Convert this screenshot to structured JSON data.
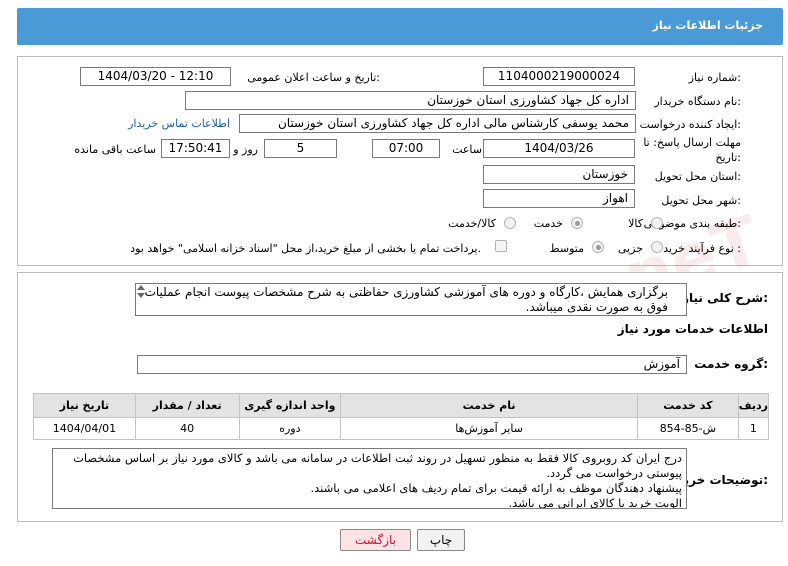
{
  "header": {
    "title": "جزئیات اطلاعات نیاز"
  },
  "form": {
    "need_number_label": "شماره نیاز:",
    "need_number": "1104000219000024",
    "announce_label": "تاریخ و ساعت اعلان عمومی:",
    "announce_value": "1404/03/20 - 12:10",
    "buyer_org_label": "نام دستگاه خریدار:",
    "buyer_org": "اداره کل جهاد کشاورزی استان خوزستان",
    "requester_label": "ایجاد کننده درخواست:",
    "requester": "محمد یوسفی کارشناس مالی اداره کل جهاد کشاورزی استان خوزستان",
    "contact_link": "اطلاعات تماس خریدار",
    "deadline_label_1": "مهلت ارسال پاسخ: تا",
    "deadline_label_2": "تاریخ:",
    "deadline_date": "1404/03/26",
    "hour_label": "ساعت",
    "deadline_time": "07:00",
    "days_value": "5",
    "days_label": "روز و",
    "remaining_time": "17:50:41",
    "remaining_label": "ساعت باقی مانده",
    "province_label": "استان محل تحویل:",
    "province": "خوزستان",
    "city_label": "شهر محل تحویل:",
    "city": "اهواز",
    "category_label": "طبقه بندی موضوعی:",
    "category_options": [
      "کالا",
      "خدمت",
      "کالا/خدمت"
    ],
    "category_selected": "خدمت",
    "process_label": "نوع فرآیند خرید :",
    "process_options": [
      "جزیی",
      "متوسط"
    ],
    "process_selected": "متوسط",
    "payment_text": "پرداخت تمام یا بخشی از مبلغ خرید،از محل \"اسناد خزانه اسلامی\" خواهد بود."
  },
  "description": {
    "label": "شرح کلی نیاز:",
    "text": "برگزاری همایش ،کارگاه و دوره های آموزشی کشاورزی حفاظتی به شرح مشخصات پیوست انجام عملیات فوق به صورت نقدی میباشد."
  },
  "services": {
    "section_title": "اطلاعات خدمات مورد نیاز",
    "group_label": "گروه خدمت:",
    "group_value": "آموزش",
    "columns": [
      "ردیف",
      "کد خدمت",
      "نام خدمت",
      "واحد اندازه گیری",
      "تعداد / مقدار",
      "تاریخ نیاز"
    ],
    "rows": [
      [
        "1",
        "ش-85-854",
        "سایر آموزش‌ها",
        "دوره",
        "40",
        "1404/04/01"
      ]
    ]
  },
  "buyer_notes": {
    "label": "توضیحات خریدار:",
    "lines": [
      "درج ایران کد روبروی کالا فقط به منظور تسهیل در روند ثبت اطلاعات در سامانه می باشد و کالای مورد نیاز بر اساس مشخصات پیوستی درخواست می گردد.",
      "پیشنهاد دهندگان موظف به ارائه قیمت برای تمام ردیف های اعلامی می باشند.",
      "الویت خرید با کالای ایرانی می باشد."
    ]
  },
  "buttons": {
    "print": "چاپ",
    "back": "بازگشت"
  },
  "watermark": "AriaTender.neT"
}
